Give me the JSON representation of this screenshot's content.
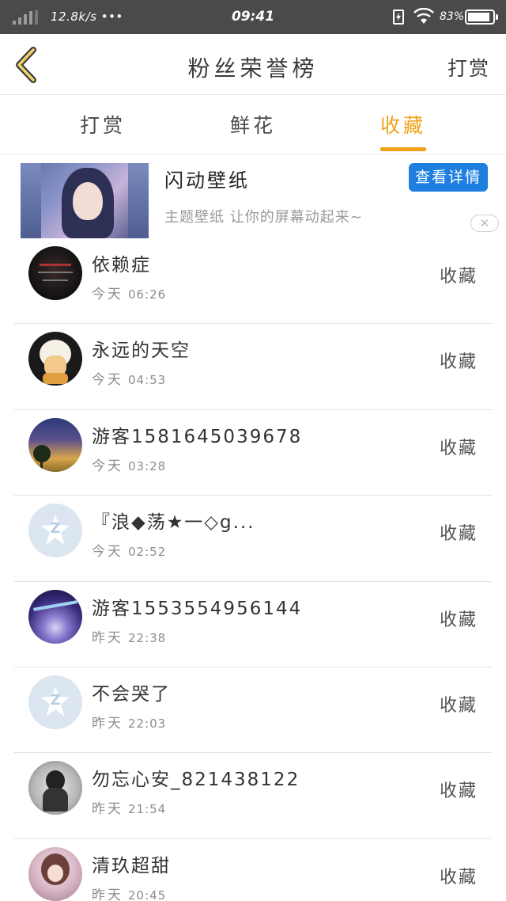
{
  "status_bar": {
    "net_speed": "12.8k/s •••",
    "time": "09:41",
    "battery": "83"
  },
  "nav": {
    "title": "粉丝荣誉榜",
    "action": "打赏"
  },
  "tabs": [
    {
      "label": "打赏",
      "active": false
    },
    {
      "label": "鲜花",
      "active": false
    },
    {
      "label": "收藏",
      "active": true
    }
  ],
  "ad": {
    "title": "闪动壁纸",
    "subtitle": "主题壁纸 让你的屏幕动起来~",
    "button": "查看详情",
    "close": "✕"
  },
  "colors": {
    "accent": "#f0a21a",
    "ad_button": "#1e7fe0",
    "status_bar": "#4a4a4a"
  },
  "list": [
    {
      "name": "依赖症",
      "day": "今天",
      "time": "06:26",
      "action": "收藏",
      "avatar": "dark-text-image"
    },
    {
      "name": "永远的天空",
      "day": "今天",
      "time": "04:53",
      "action": "收藏",
      "avatar": "sheep-cartoon"
    },
    {
      "name": "游客1581645039678",
      "day": "今天",
      "time": "03:28",
      "action": "收藏",
      "avatar": "sunset-tree"
    },
    {
      "name": "『浪◆荡★一◇g...",
      "day": "今天",
      "time": "02:52",
      "action": "收藏",
      "avatar": "qq-default"
    },
    {
      "name": "游客1553554956144",
      "day": "昨天",
      "time": "22:38",
      "action": "收藏",
      "avatar": "purple-moon"
    },
    {
      "name": "不会哭了",
      "day": "昨天",
      "time": "22:03",
      "action": "收藏",
      "avatar": "qq-default"
    },
    {
      "name": "勿忘心安_821438122",
      "day": "昨天",
      "time": "21:54",
      "action": "收藏",
      "avatar": "bw-girl"
    },
    {
      "name": "清玖超甜",
      "day": "昨天",
      "time": "20:45",
      "action": "收藏",
      "avatar": "anime-girl"
    }
  ]
}
